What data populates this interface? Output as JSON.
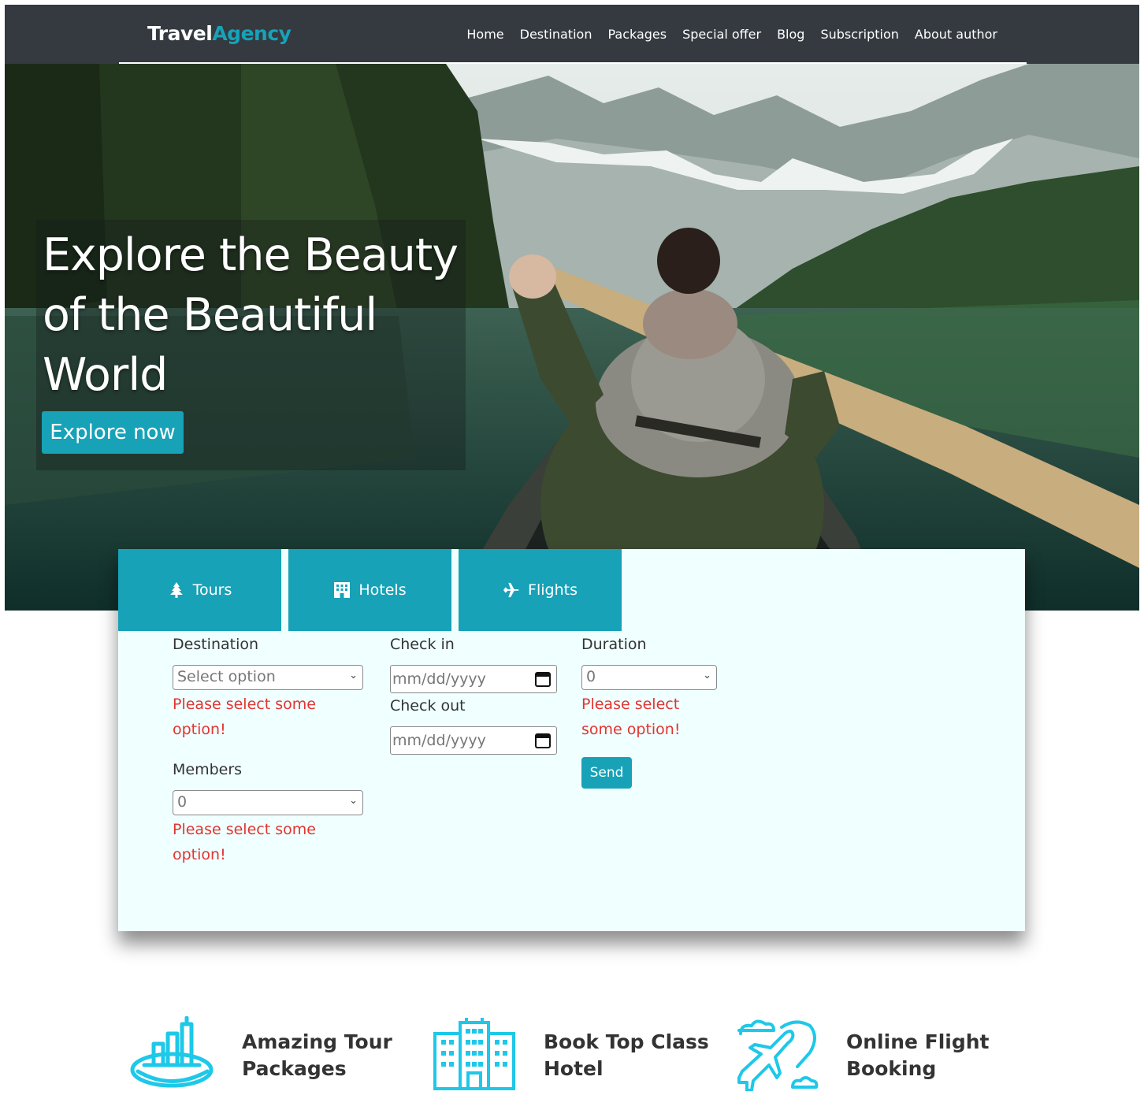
{
  "brand": {
    "part1": "Travel",
    "part2": "Agency"
  },
  "nav": [
    "Home",
    "Destination",
    "Packages",
    "Special offer",
    "Blog",
    "Subscription",
    "About author"
  ],
  "hero": {
    "title": "Explore the Beauty of the Beautiful World",
    "button": "Explore now"
  },
  "tabs": [
    {
      "label": "Tours",
      "icon": "tree-icon"
    },
    {
      "label": "Hotels",
      "icon": "hotel-icon"
    },
    {
      "label": "Flights",
      "icon": "plane-icon"
    }
  ],
  "form": {
    "destination_label": "Destination",
    "destination_value": "Select option",
    "destination_error": "Please select some option!",
    "members_label": "Members",
    "members_value": "0",
    "members_error": "Please select some option!",
    "checkin_label": "Check in",
    "checkin_placeholder": "mm/dd/yyyy",
    "checkout_label": "Check out",
    "checkout_placeholder": "mm/dd/yyyy",
    "duration_label": "Duration",
    "duration_value": "0",
    "duration_error": "Please select some option!",
    "send": "Send"
  },
  "features": [
    {
      "title": "Amazing Tour Packages",
      "icon": "tour-package-icon"
    },
    {
      "title": "Book Top Class Hotel",
      "icon": "hotel-building-icon"
    },
    {
      "title": "Online Flight Booking",
      "icon": "flight-booking-icon"
    }
  ],
  "colors": {
    "accent": "#17a2b8",
    "navbar": "#343a40",
    "panel": "#f0ffff",
    "error": "#e3342f",
    "icon": "#1ec8e8"
  }
}
